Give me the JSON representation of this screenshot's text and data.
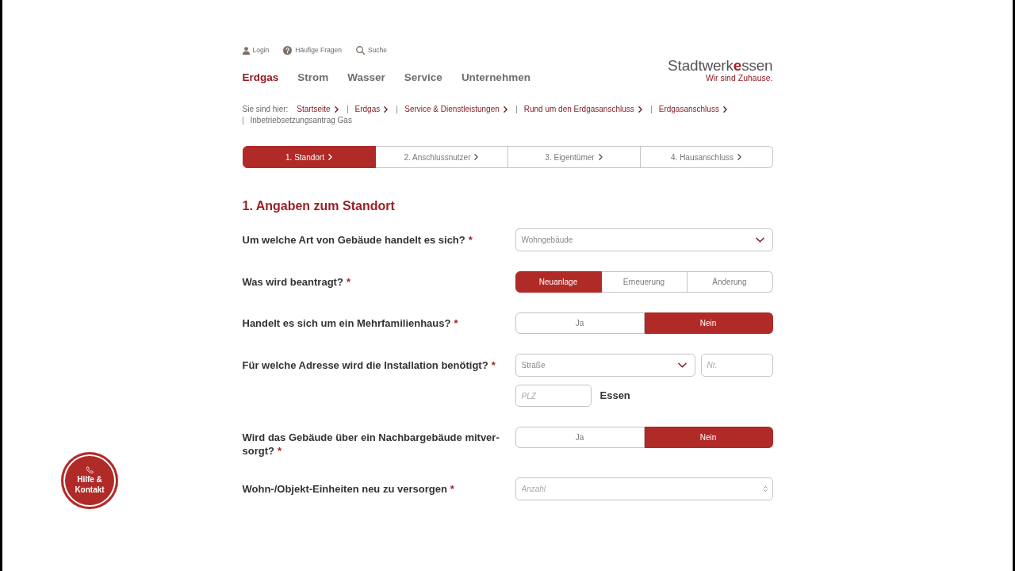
{
  "top_links": [
    {
      "kind": "login",
      "label": "Login"
    },
    {
      "kind": "faq",
      "label": "Häufige Fragen"
    },
    {
      "kind": "search",
      "label": "Suche"
    }
  ],
  "main_nav": [
    {
      "label": "Erdgas",
      "selected": true
    },
    {
      "label": "Strom",
      "selected": false
    },
    {
      "label": "Wasser",
      "selected": false
    },
    {
      "label": "Service",
      "selected": false
    },
    {
      "label": "Unternehmen",
      "selected": false
    }
  ],
  "logo": {
    "name": "Stadtwerk**e**ssen",
    "tagline": "Wir sind Zuhause."
  },
  "breadcrumb": {
    "prefix": "Sie sind hier:",
    "items": [
      {
        "label": "Startseite",
        "current": false
      },
      {
        "label": "Erdgas",
        "current": false
      },
      {
        "label": "Service & Dienstleistungen",
        "current": false
      },
      {
        "label": "Rund um den Erdgasanschluss",
        "current": false
      },
      {
        "label": "Erdgasanschluss",
        "current": false
      },
      {
        "label": "Inbetriebsetzungsantrag Gas",
        "current": true
      }
    ]
  },
  "steps": [
    {
      "label": "1. Standort",
      "selected": true
    },
    {
      "label": "2. Anschlussnutzer",
      "selected": false
    },
    {
      "label": "3. Eigentümer",
      "selected": false
    },
    {
      "label": "4. Hausanschluss",
      "selected": false
    }
  ],
  "section_title": "1. Angaben zum Standort",
  "fields": [
    {
      "kind": "select",
      "label": "Um welche Art von Gebäude handelt es sich?",
      "required_mark": "*",
      "value": "Wohngebäude"
    },
    {
      "kind": "choice",
      "label": "Was wird beantragt?",
      "required_mark": "*",
      "options": [
        {
          "label": "Neuanlage",
          "selected": true
        },
        {
          "label": "Erneuerung",
          "selected": false
        },
        {
          "label": "Änderung",
          "selected": false
        }
      ]
    },
    {
      "kind": "choice",
      "label": "Handelt es sich um ein Mehrfamilienhaus?",
      "required_mark": "*",
      "options": [
        {
          "label": "Ja",
          "selected": false
        },
        {
          "label": "Nein",
          "selected": true
        }
      ]
    },
    {
      "kind": "address",
      "label": "Für welche Adresse wird die Installation benötigt?",
      "required_mark": "*",
      "street": {
        "placeholder": "Straße"
      },
      "number": {
        "placeholder": "Nr."
      },
      "zip": {
        "placeholder": "PLZ"
      },
      "city": "Essen"
    },
    {
      "kind": "choice",
      "label": "Wird das Gebäude über ein Nachbargebäude mitver-sorgt?",
      "required_mark": "*",
      "options": [
        {
          "label": "Ja",
          "selected": false
        },
        {
          "label": "Nein",
          "selected": true
        }
      ]
    },
    {
      "kind": "number",
      "label": "Wohn-/Objekt-Einheiten neu zu versorgen",
      "required_mark": "*",
      "placeholder": "Anzahl"
    }
  ],
  "help_button": {
    "label": "Hilfe & Kontakt"
  }
}
